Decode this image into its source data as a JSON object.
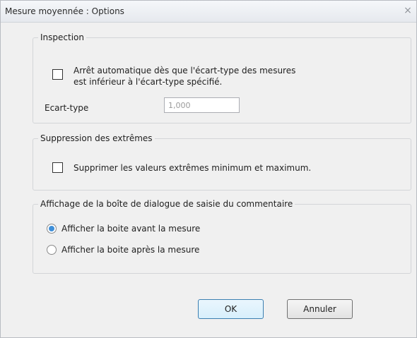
{
  "window": {
    "title": "Mesure moyennée  : Options",
    "close_glyph": "×"
  },
  "inspection": {
    "legend": "Inspection",
    "auto_stop_line1": "Arrêt automatique dès que l'écart-type des mesures",
    "auto_stop_line2": "est inférieur à l'écart-type spécifié.",
    "auto_stop_checked": false,
    "std_label": "Ecart-type",
    "std_value": "1,000"
  },
  "extremes": {
    "legend": "Suppression des extrêmes",
    "remove_label": "Supprimer les valeurs extrêmes minimum et maximum.",
    "remove_checked": false
  },
  "comment_dialog": {
    "legend": "Affichage de la boîte de dialogue de saisie du commentaire",
    "before_label": "Afficher la boite avant la mesure",
    "after_label": "Afficher la boite après la mesure",
    "selected": "before"
  },
  "buttons": {
    "ok_label": "OK",
    "cancel_label": "Annuler"
  },
  "colors": {
    "radio_selected": "#3f8fd8",
    "default_button_border": "#3c7fb1"
  }
}
